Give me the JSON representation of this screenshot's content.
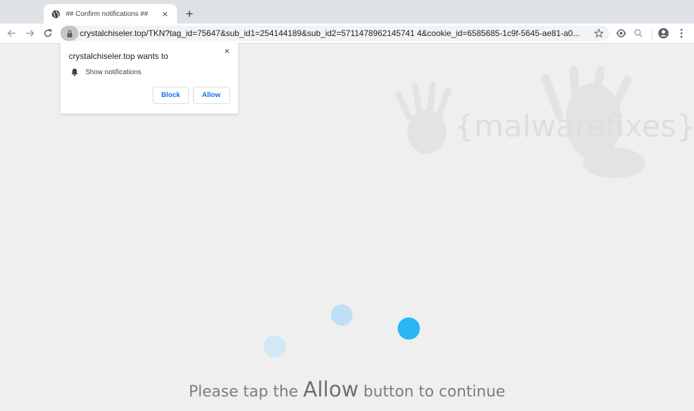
{
  "tab": {
    "title": "## Confirm notifications ##",
    "favicon": "globe-icon",
    "close": "×"
  },
  "newtab": {
    "label": "+"
  },
  "toolbar": {
    "url": "crystalchiseler.top/TKN?tag_id=75647&sub_id1=254144189&sub_id2=5711478962145741 4&cookie_id=6585685-1c9f-5645-ae81-a0...",
    "icons": [
      "back-icon",
      "forward-icon",
      "reload-icon",
      "lock-icon",
      "star-icon",
      "extension-icon",
      "zoom-icon",
      "account-icon",
      "menu-icon"
    ]
  },
  "popup": {
    "title": "crystalchiseler.top wants to",
    "permission": "Show notifications",
    "block_label": "Block",
    "allow_label": "Allow",
    "close": "×"
  },
  "watermark": {
    "text": "{malwarefixes}"
  },
  "cta": {
    "prefix": "Please tap the",
    "emphasis": "Allow",
    "suffix": "button to continue"
  },
  "colors": {
    "accent": "#1a73e8",
    "dot_primary": "#29b6f6",
    "dot_light": "#bfdff7",
    "dot_lighter": "#d3e8f7"
  }
}
